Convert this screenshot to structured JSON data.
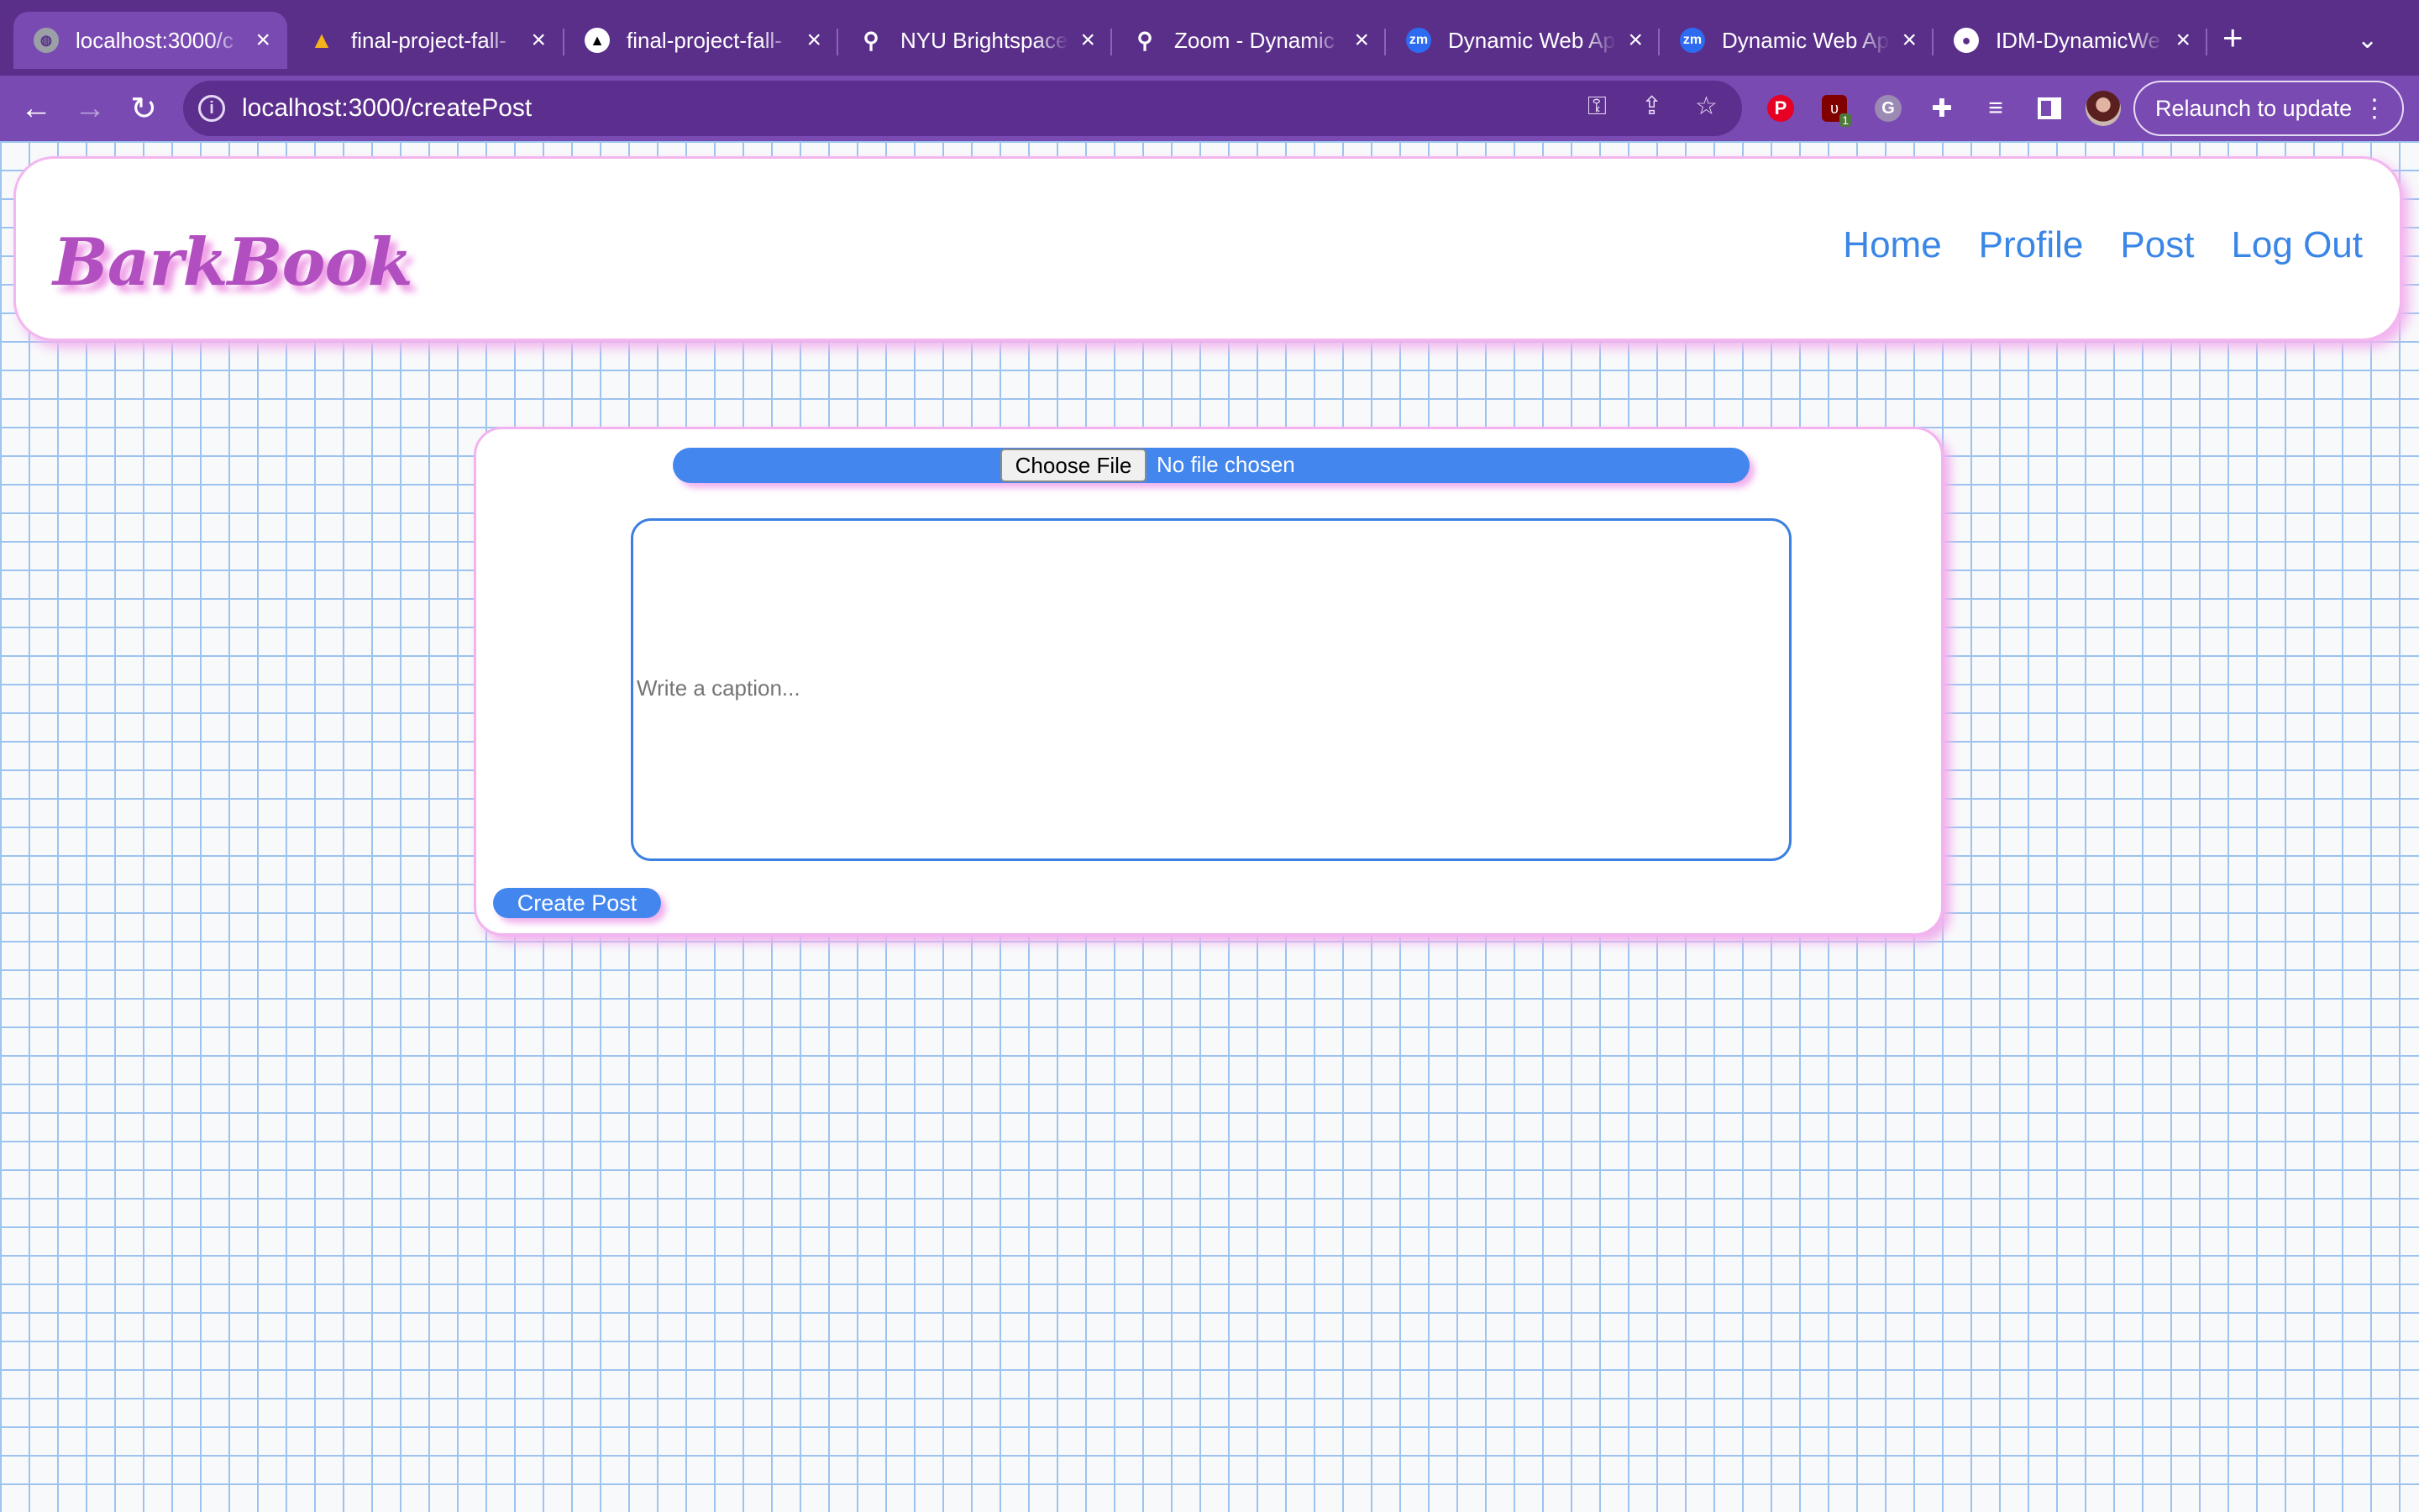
{
  "browser": {
    "tabs": [
      {
        "title": "localhost:3000/c",
        "icon": "globe-icon"
      },
      {
        "title": "final-project-fall-",
        "icon": "firebase-icon"
      },
      {
        "title": "final-project-fall-",
        "icon": "vercel-icon"
      },
      {
        "title": "NYU Brightspace",
        "icon": "brightspace-icon"
      },
      {
        "title": "Zoom - Dynamic",
        "icon": "brightspace-icon"
      },
      {
        "title": "Dynamic Web Ap",
        "icon": "zoom-icon",
        "badge": "zm"
      },
      {
        "title": "Dynamic Web Ap",
        "icon": "zoom-icon",
        "badge": "zm"
      },
      {
        "title": "IDM-DynamicWe",
        "icon": "github-icon"
      }
    ],
    "url": "localhost:3000/createPost",
    "relaunch_label": "Relaunch to update",
    "ext_badge": "1"
  },
  "navbar": {
    "logo": "BarkBook",
    "links": [
      "Home",
      "Profile",
      "Post",
      "Log Out"
    ]
  },
  "form": {
    "choose_file_label": "Choose File",
    "no_file_text": "No file chosen",
    "caption_placeholder": "Write a caption...",
    "submit_label": "Create Post"
  },
  "colors": {
    "tabstrip": "#5a2f8a",
    "toolbar": "#7a4ab3",
    "logo": "#b24fc0",
    "link": "#3a86e6",
    "button": "#4286ee",
    "pink_border": "#f3b6ef",
    "grid_line": "#9dc3ef"
  }
}
